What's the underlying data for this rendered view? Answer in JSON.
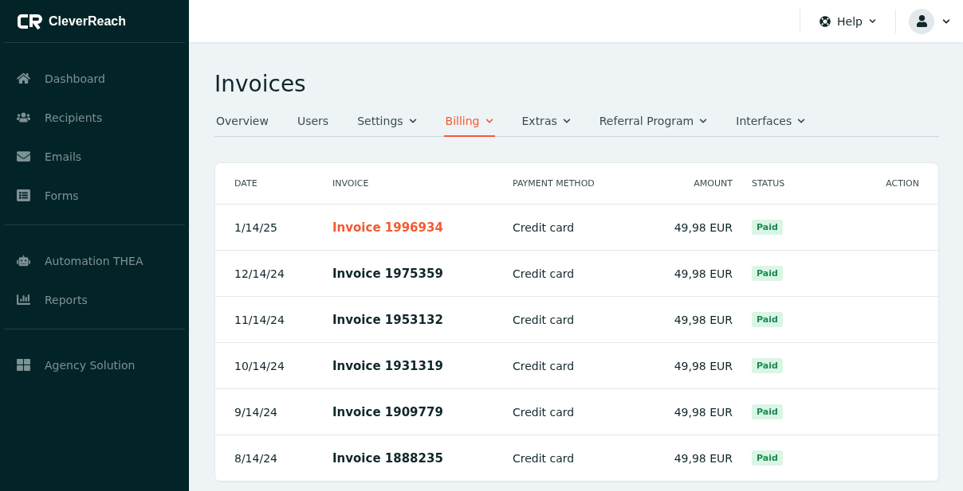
{
  "brand": {
    "name": "CleverReach"
  },
  "sidebar": {
    "groups": [
      {
        "items": [
          {
            "label": "Dashboard"
          },
          {
            "label": "Recipients"
          },
          {
            "label": "Emails"
          },
          {
            "label": "Forms"
          }
        ]
      },
      {
        "items": [
          {
            "label": "Automation THEA"
          },
          {
            "label": "Reports"
          }
        ]
      },
      {
        "items": [
          {
            "label": "Agency Solution"
          }
        ]
      }
    ]
  },
  "topbar": {
    "help": "Help"
  },
  "page": {
    "title": "Invoices"
  },
  "tabs": [
    {
      "label": "Overview",
      "dropdown": false,
      "selected": false
    },
    {
      "label": "Users",
      "dropdown": false,
      "selected": false
    },
    {
      "label": "Settings",
      "dropdown": true,
      "selected": false
    },
    {
      "label": "Billing",
      "dropdown": true,
      "selected": true
    },
    {
      "label": "Extras",
      "dropdown": true,
      "selected": false
    },
    {
      "label": "Referral Program",
      "dropdown": true,
      "selected": false
    },
    {
      "label": "Interfaces",
      "dropdown": true,
      "selected": false
    }
  ],
  "table": {
    "columns": [
      "DATE",
      "INVOICE",
      "PAYMENT METHOD",
      "AMOUNT",
      "STATUS",
      "ACTION"
    ],
    "rows": [
      {
        "date": "1/14/25",
        "invoice": "Invoice 1996934",
        "highlighted": true,
        "method": "Credit card",
        "amount": "49,98 EUR",
        "status": "Paid"
      },
      {
        "date": "12/14/24",
        "invoice": "Invoice 1975359",
        "highlighted": false,
        "method": "Credit card",
        "amount": "49,98 EUR",
        "status": "Paid"
      },
      {
        "date": "11/14/24",
        "invoice": "Invoice 1953132",
        "highlighted": false,
        "method": "Credit card",
        "amount": "49,98 EUR",
        "status": "Paid"
      },
      {
        "date": "10/14/24",
        "invoice": "Invoice 1931319",
        "highlighted": false,
        "method": "Credit card",
        "amount": "49,98 EUR",
        "status": "Paid"
      },
      {
        "date": "9/14/24",
        "invoice": "Invoice 1909779",
        "highlighted": false,
        "method": "Credit card",
        "amount": "49,98 EUR",
        "status": "Paid"
      },
      {
        "date": "8/14/24",
        "invoice": "Invoice 1888235",
        "highlighted": false,
        "method": "Credit card",
        "amount": "49,98 EUR",
        "status": "Paid"
      }
    ]
  }
}
